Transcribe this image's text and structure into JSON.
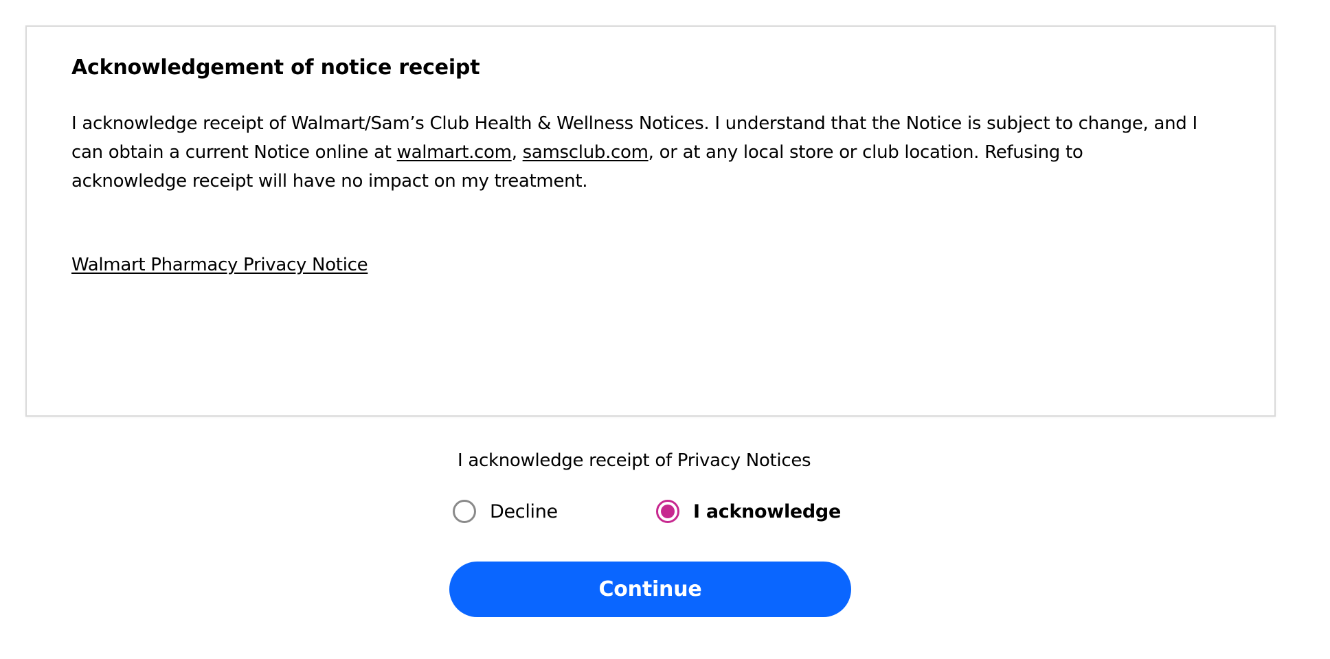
{
  "notice": {
    "title": "Acknowledgement of notice receipt",
    "body_part1": "I acknowledge receipt of Walmart/Sam’s Club Health & Wellness Notices. I understand that the Notice is subject to change, and I can obtain a current Notice online at ",
    "link_walmart": "walmart.com",
    "body_sep": ", ",
    "link_samsclub": "samsclub.com",
    "body_part2": ", or at any local store or club location. Refusing to acknowledge receipt will have no impact on my treatment.",
    "privacy_link": "Walmart Pharmacy Privacy Notice"
  },
  "acknowledgement": {
    "question": "I acknowledge receipt of Privacy Notices",
    "options": [
      {
        "label": "Decline",
        "selected": false
      },
      {
        "label": "I acknowledge",
        "selected": true
      }
    ]
  },
  "actions": {
    "continue_label": "Continue"
  },
  "colors": {
    "primary_button": "#0a66ff",
    "radio_selected": "#c7288f",
    "card_border": "#dadada"
  }
}
